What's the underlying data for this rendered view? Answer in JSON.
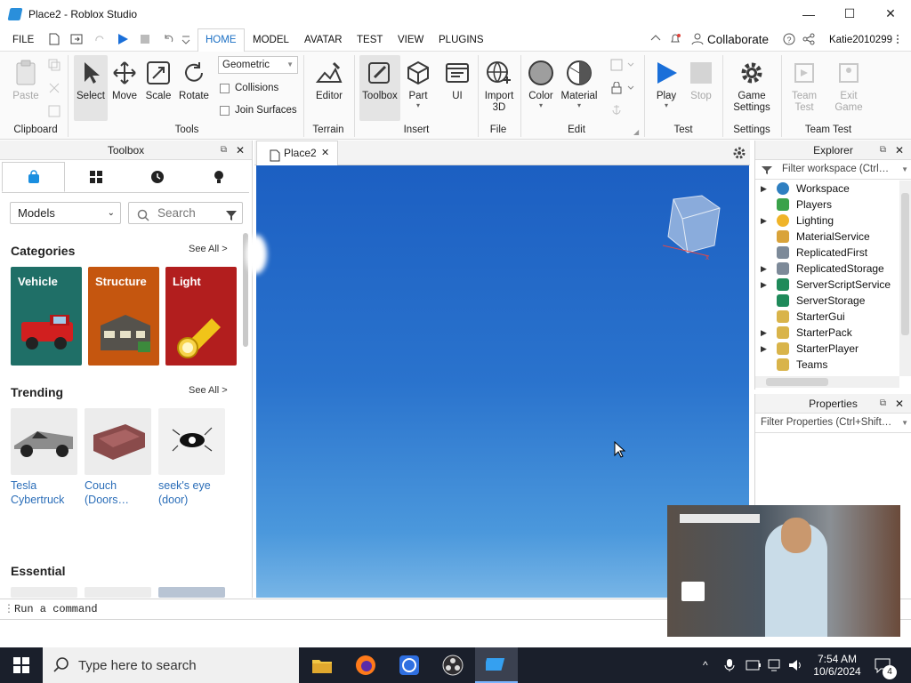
{
  "window": {
    "title": "Place2 - Roblox Studio",
    "minimize": "—",
    "maximize": "☐",
    "close": "✕"
  },
  "menu": {
    "file": "FILE",
    "tabs": [
      "HOME",
      "MODEL",
      "AVATAR",
      "TEST",
      "VIEW",
      "PLUGINS"
    ],
    "collaborate": "Collaborate",
    "username": "Katie2010299"
  },
  "ribbon": {
    "clipboard": {
      "paste": "Paste",
      "group": "Clipboard"
    },
    "tools": {
      "select": "Select",
      "move": "Move",
      "scale": "Scale",
      "rotate": "Rotate",
      "dropdown": "Geometric",
      "collisions": "Collisions",
      "join_surfaces": "Join Surfaces",
      "group": "Tools"
    },
    "terrain": {
      "editor": "Editor",
      "group": "Terrain"
    },
    "insert": {
      "toolbox": "Toolbox",
      "part": "Part",
      "ui": "UI",
      "group": "Insert"
    },
    "file": {
      "import": "Import",
      "import2": "3D",
      "group": "File"
    },
    "edit": {
      "color": "Color",
      "material": "Material",
      "group": "Edit"
    },
    "test": {
      "play": "Play",
      "stop": "Stop",
      "group": "Test"
    },
    "settings": {
      "game": "Game",
      "game2": "Settings",
      "group": "Settings"
    },
    "teamtest": {
      "team": "Team",
      "team2": "Test",
      "exit": "Exit",
      "exit2": "Game",
      "group": "Team Test"
    }
  },
  "toolbox": {
    "title": "Toolbox",
    "category_select": "Models",
    "search_placeholder": "Search",
    "categories_title": "Categories",
    "see_all": "See All >",
    "categories": [
      {
        "label": "Vehicle",
        "color": "#1f6f67"
      },
      {
        "label": "Structure",
        "color": "#c5560f"
      },
      {
        "label": "Light",
        "color": "#b21e1e"
      }
    ],
    "trending_title": "Trending",
    "trending": [
      {
        "line1": "Tesla",
        "line2": "Cybertruck"
      },
      {
        "line1": "Couch",
        "line2": "(Doors…"
      },
      {
        "line1": "seek's eye",
        "line2": "(door)"
      }
    ],
    "essential_title": "Essential"
  },
  "document": {
    "tab": "Place2"
  },
  "explorer": {
    "title": "Explorer",
    "filter": "Filter workspace (Ctrl…",
    "items": [
      {
        "label": "Workspace",
        "expand": true,
        "color": "#2f7fc1"
      },
      {
        "label": "Players",
        "expand": false,
        "color": "#3aa24a"
      },
      {
        "label": "Lighting",
        "expand": true,
        "color": "#f0b429"
      },
      {
        "label": "MaterialService",
        "expand": false,
        "color": "#d9a33a"
      },
      {
        "label": "ReplicatedFirst",
        "expand": false,
        "color": "#7d8a99"
      },
      {
        "label": "ReplicatedStorage",
        "expand": true,
        "color": "#7d8a99"
      },
      {
        "label": "ServerScriptService",
        "expand": true,
        "color": "#1f8a5a"
      },
      {
        "label": "ServerStorage",
        "expand": false,
        "color": "#1f8a5a"
      },
      {
        "label": "StarterGui",
        "expand": false,
        "color": "#d9b44a"
      },
      {
        "label": "StarterPack",
        "expand": true,
        "color": "#d9b44a"
      },
      {
        "label": "StarterPlayer",
        "expand": true,
        "color": "#d9b44a"
      },
      {
        "label": "Teams",
        "expand": false,
        "color": "#d9b44a"
      }
    ]
  },
  "properties": {
    "title": "Properties",
    "filter": "Filter Properties (Ctrl+Shift…"
  },
  "command": {
    "placeholder": "Run a command"
  },
  "taskbar": {
    "search": "Type here to search",
    "time": "7:54 AM",
    "date": "10/6/2024",
    "notifications": "4"
  }
}
